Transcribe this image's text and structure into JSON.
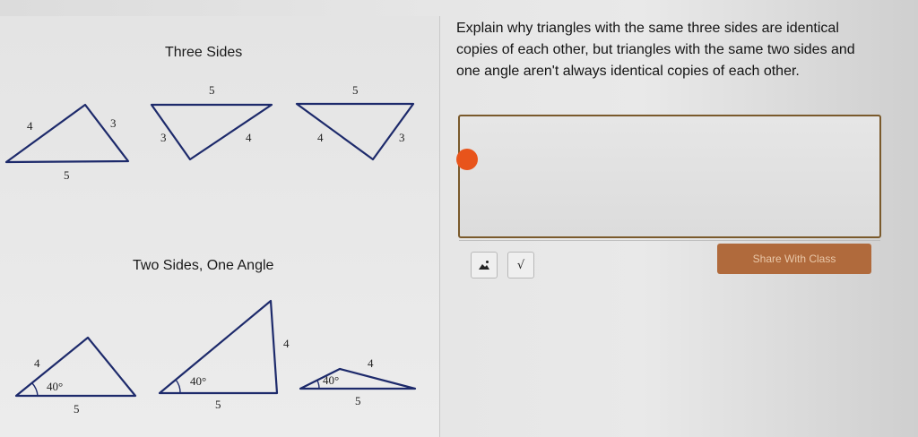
{
  "three_sides": {
    "title": "Three Sides",
    "triangle1": {
      "left_side": "4",
      "right_side": "3",
      "bottom_side": "5"
    },
    "triangle2": {
      "top_side": "5",
      "left_side": "3",
      "right_side": "4"
    },
    "triangle3": {
      "top_side": "5",
      "left_side": "4",
      "right_side": "3"
    }
  },
  "two_sides_one_angle": {
    "title": "Two Sides, One Angle",
    "triangle1": {
      "side": "4",
      "angle": "40°",
      "base": "5"
    },
    "triangle2": {
      "side": "4",
      "angle": "40°",
      "base": "5"
    },
    "triangle3": {
      "side": "4",
      "angle": "40°",
      "base": "5"
    }
  },
  "question": {
    "text": "Explain why triangles with the same three sides are identical copies of each other, but triangles with the same two sides and one angle aren't always identical copies of each other."
  },
  "answer": {
    "value": ""
  },
  "toolbar": {
    "image_icon": "image-icon",
    "sqrt_label": "√",
    "share_label": "Share With Class"
  },
  "colors": {
    "accent": "#b06a3c",
    "cursor": "#e8541b",
    "triangle_stroke": "#1d2a6b"
  }
}
